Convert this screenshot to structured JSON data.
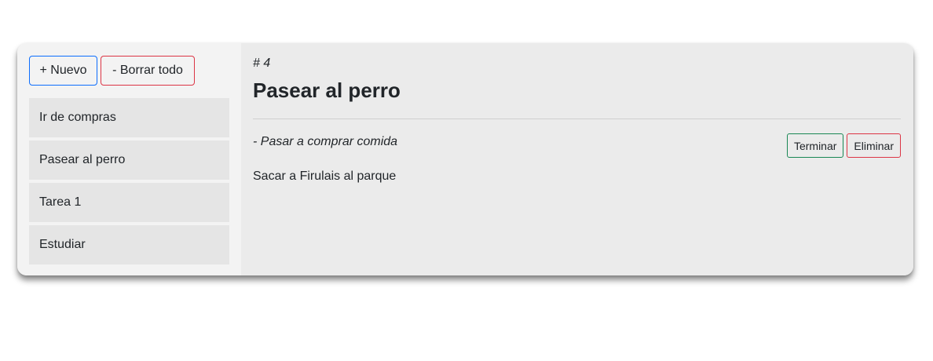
{
  "sidebar": {
    "new_label": "+ Nuevo",
    "clear_label": "- Borrar todo",
    "items": [
      {
        "label": "Ir de compras"
      },
      {
        "label": "Pasear al perro"
      },
      {
        "label": "Tarea 1"
      },
      {
        "label": "Estudiar"
      }
    ]
  },
  "detail": {
    "id_label": "# 4",
    "title": "Pasear al perro",
    "subtitle": "- Pasar a comprar comida",
    "finish_label": "Terminar",
    "delete_label": "Eliminar",
    "body": "Sacar a Firulais al parque"
  },
  "colors": {
    "primary": "#0d6efd",
    "danger": "#dc3545",
    "success": "#198754"
  }
}
